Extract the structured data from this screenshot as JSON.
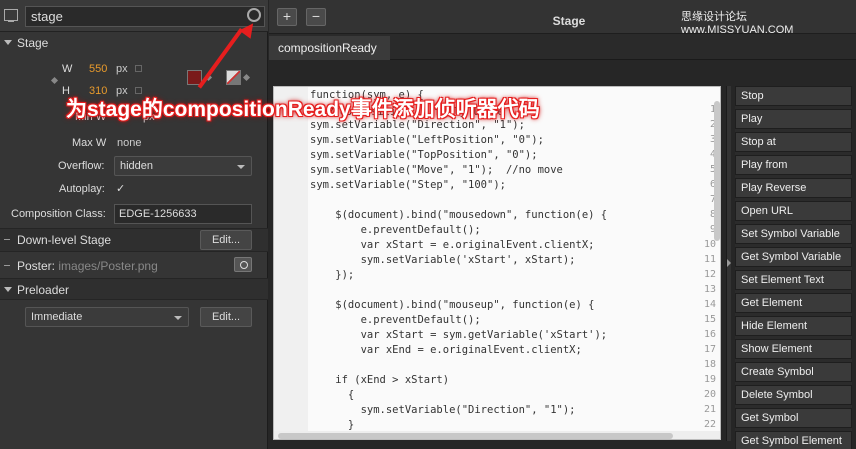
{
  "properties": {
    "element_name": "stage",
    "stage_section": "Stage",
    "width_label": "W",
    "width_value": "550",
    "width_unit": "px",
    "height_label": "H",
    "height_value": "310",
    "height_unit": "px",
    "min_w_label": "Min W",
    "min_w_unit": "px",
    "max_w_label": "Max W",
    "max_w_value": "none",
    "overflow_label": "Overflow:",
    "overflow_value": "hidden",
    "autoplay_label": "Autoplay:",
    "autoplay_checked": "✓",
    "composition_class_label": "Composition Class:",
    "composition_class_value": "EDGE-1256633",
    "downlevel_label": "Down-level Stage",
    "downlevel_edit": "Edit...",
    "poster_label": "Poster:",
    "poster_path": "images/Poster.png",
    "preloader_section": "Preloader",
    "preloader_value": "Immediate",
    "preloader_edit": "Edit...",
    "bg_color": "#7a1a1a"
  },
  "code_window": {
    "title": "Stage",
    "add_button": "+",
    "remove_button": "−",
    "watermark": "思缘设计论坛  www.MISSYUAN.COM",
    "tab": "compositionReady",
    "lines": [
      {
        "n": "",
        "text": "function(sym, e) {"
      },
      {
        "n": "1",
        "text": "// 在composition is fully loade"
      },
      {
        "n": "2",
        "text": "sym.setVariable(\"Direction\", \"1\");"
      },
      {
        "n": "3",
        "text": "sym.setVariable(\"LeftPosition\", \"0\");"
      },
      {
        "n": "4",
        "text": "sym.setVariable(\"TopPosition\", \"0\");"
      },
      {
        "n": "5",
        "text": "sym.setVariable(\"Move\", \"1\");  //no move"
      },
      {
        "n": "6",
        "text": "sym.setVariable(\"Step\", \"100\");"
      },
      {
        "n": "7",
        "text": ""
      },
      {
        "n": "8",
        "text": "    $(document).bind(\"mousedown\", function(e) {"
      },
      {
        "n": "9",
        "text": "        e.preventDefault();"
      },
      {
        "n": "10",
        "text": "        var xStart = e.originalEvent.clientX;"
      },
      {
        "n": "11",
        "text": "        sym.setVariable('xStart', xStart);"
      },
      {
        "n": "12",
        "text": "    });"
      },
      {
        "n": "13",
        "text": ""
      },
      {
        "n": "14",
        "text": "    $(document).bind(\"mouseup\", function(e) {"
      },
      {
        "n": "15",
        "text": "        e.preventDefault();"
      },
      {
        "n": "16",
        "text": "        var xStart = sym.getVariable('xStart');"
      },
      {
        "n": "17",
        "text": "        var xEnd = e.originalEvent.clientX;"
      },
      {
        "n": "18",
        "text": ""
      },
      {
        "n": "19",
        "text": "    if (xEnd > xStart)"
      },
      {
        "n": "20",
        "text": "      {"
      },
      {
        "n": "21",
        "text": "        sym.setVariable(\"Direction\", \"1\");"
      },
      {
        "n": "22",
        "text": "      }"
      }
    ],
    "snippets": [
      "Stop",
      "Play",
      "Stop at",
      "Play from",
      "Play Reverse",
      "Open URL",
      "Set Symbol Variable",
      "Get Symbol Variable",
      "Set Element Text",
      "Get Element",
      "Hide Element",
      "Show Element",
      "Create Symbol",
      "Delete Symbol",
      "Get Symbol",
      "Get Symbol Element"
    ]
  },
  "annotation": {
    "text": "为stage的compositionReady事件添加侦听器代码",
    "color": "#e61e1e"
  }
}
